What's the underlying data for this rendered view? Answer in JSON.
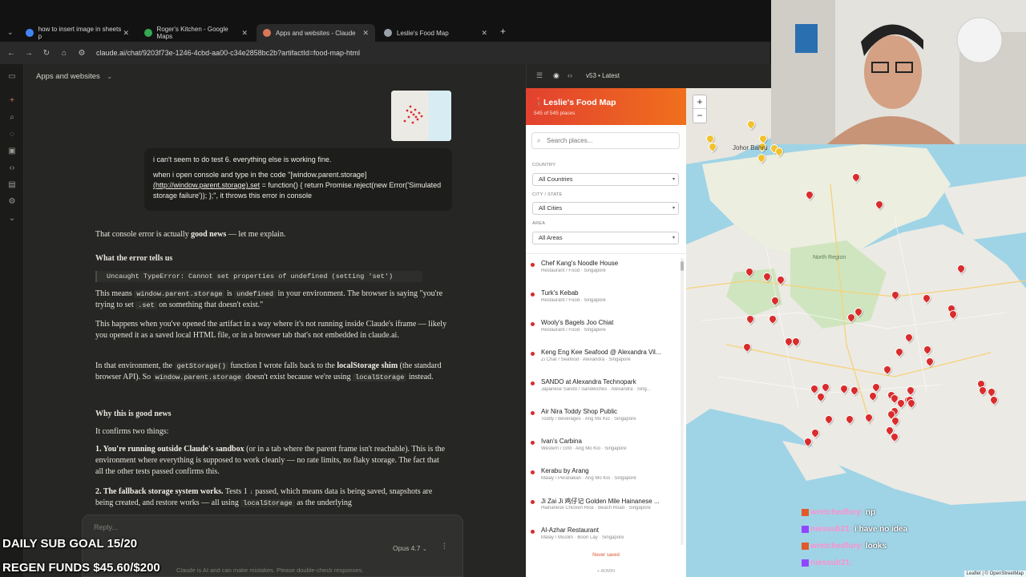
{
  "browser": {
    "tabs": [
      {
        "label": "how to insert image in sheets p",
        "active": false,
        "favicon_color": "#4285f4"
      },
      {
        "label": "Roger's Kitchen - Google Maps",
        "active": false,
        "favicon_color": "#34a853"
      },
      {
        "label": "Apps and websites - Claude",
        "active": true,
        "favicon_color": "#d97757"
      },
      {
        "label": "Leslie's Food Map",
        "active": false,
        "favicon_color": "#9aa0a6"
      }
    ],
    "new_tab": "+",
    "url": "claude.ai/chat/9203f73e-1246-4cbd-aa00-c34e2858bc2b?artifactId=food-map-html"
  },
  "chat": {
    "project_title": "Apps and websites",
    "user_message": {
      "line1": "i can't seem to do test 6. everything else is working fine.",
      "line2a": "when i open console and type in the code \"[window.parent.storage]",
      "line2_link": "(http://window.parent.storage).set",
      "line2b": " = function() { return Promise.reject(new Error('Simulated storage failure')); };\", it throws this error in console"
    },
    "response": {
      "intro_a": "That console error is actually ",
      "intro_b": "good news",
      "intro_c": " — let me explain.",
      "h1": "What the error tells us",
      "error_code": "Uncaught TypeError: Cannot set properties of undefined (setting 'set')",
      "p1_a": "This means ",
      "p1_code1": "window.parent.storage",
      "p1_b": " is ",
      "p1_code2": "undefined",
      "p1_c": " in your environment. The browser is saying \"you're trying to set ",
      "p1_code3": ".set",
      "p1_d": " on something that doesn't exist.\"",
      "p2": "This happens when you've opened the artifact in a way where it's not running inside Claude's iframe — likely you opened it as a saved local HTML file, or in a browser tab that's not embedded in claude.ai.",
      "p3_a": "In that environment, the ",
      "p3_code1": "getStorage()",
      "p3_b": " function I wrote falls back to the ",
      "p3_bold": "localStorage shim",
      "p3_c": " (the standard browser API). So ",
      "p3_code2": "window.parent.storage",
      "p3_d": " doesn't exist because we're using ",
      "p3_code3": "localStorage",
      "p3_e": " instead.",
      "h2": "Why this is good news",
      "p4": "It confirms two things:",
      "item1_bold": "1. You're running outside Claude's sandbox",
      "item1_rest": " (or in a tab where the parent frame isn't reachable). This is the environment where everything is supposed to work cleanly — no rate limits, no flaky storage. The fact that all the other tests passed confirms this.",
      "item2_bold": "2. The fallback storage system works.",
      "item2_a": " Tests 1",
      "item2_b": " passed, which means data is being saved, snapshots are being created, and restore works — all using ",
      "item2_code": "localStorage",
      "item2_c": " as the underlying"
    },
    "composer": {
      "placeholder": "Reply...",
      "model": "Opus 4.7"
    },
    "disclaimer": "Claude is AI and can make mistakes. Please double-check responses."
  },
  "artifact": {
    "version": "v53 • Latest",
    "app_title": "Leslie's Food Map",
    "app_subtitle": "545 of 545 places",
    "search_placeholder": "Search places...",
    "filters": [
      {
        "label": "COUNTRY",
        "value": "All Countries"
      },
      {
        "label": "CITY / STATE",
        "value": "All Cities"
      },
      {
        "label": "AREA",
        "value": "All Areas"
      }
    ],
    "places": [
      {
        "name": "Chef Kang's Noodle House",
        "meta": "Restaurant / Food · Singapore"
      },
      {
        "name": "Turk's Kebab",
        "meta": "Restaurant / Food · Singapore"
      },
      {
        "name": "Wooly's Bagels Joo Chiat",
        "meta": "Restaurant / Food · Singapore"
      },
      {
        "name": "Keng Eng Kee Seafood @ Alexandra Vil...",
        "meta": "Zi Char / Seafood · Alexandra · Singapore"
      },
      {
        "name": "SANDO at Alexandra Technopark",
        "meta": "Japanese Sando / Sandwiches · Alexandra · Sing..."
      },
      {
        "name": "Air Nira Toddy Shop Public",
        "meta": "Toddy / Beverages · Ang Mo Kio · Singapore"
      },
      {
        "name": "Ivan's Carbina",
        "meta": "Western / Grill · Ang Mo Kio · Singapore"
      },
      {
        "name": "Kerabu by Arang",
        "meta": "Malay / Peranakan · Ang Mo Kio · Singapore"
      },
      {
        "name": "Ji Zai Ji 鸡仔记 Golden Mile Hainanese ...",
        "meta": "Hainanese Chicken Rice · Beach Road · Singapore"
      },
      {
        "name": "Al-Azhar Restaurant",
        "meta": "Malay / Muslim · Boon Lay · Singapore"
      }
    ],
    "never_saved": "Never saved",
    "admin": "+ ADMIN"
  },
  "map": {
    "labels": [
      "Johor Bahru",
      "North Region"
    ],
    "zoom_in": "+",
    "zoom_out": "−",
    "attribution": "Leaflet | © OpenStreetMap"
  },
  "overlay": {
    "chat": [
      {
        "user": "wretchedfury:",
        "msg": "np"
      },
      {
        "user": "niessuh21:",
        "msg": "i have no idea"
      },
      {
        "user": "wretchedfury:",
        "msg": "looks"
      },
      {
        "user": "niessuh21:",
        "msg": ""
      }
    ],
    "sub_goal": "DAILY SUB GOAL 15/20",
    "regen": "REGEN FUNDS $45.60/$200"
  },
  "colors": {
    "accent": "#e2412f",
    "pin": "#d92c2c",
    "pin_yellow": "#f2c12e"
  }
}
